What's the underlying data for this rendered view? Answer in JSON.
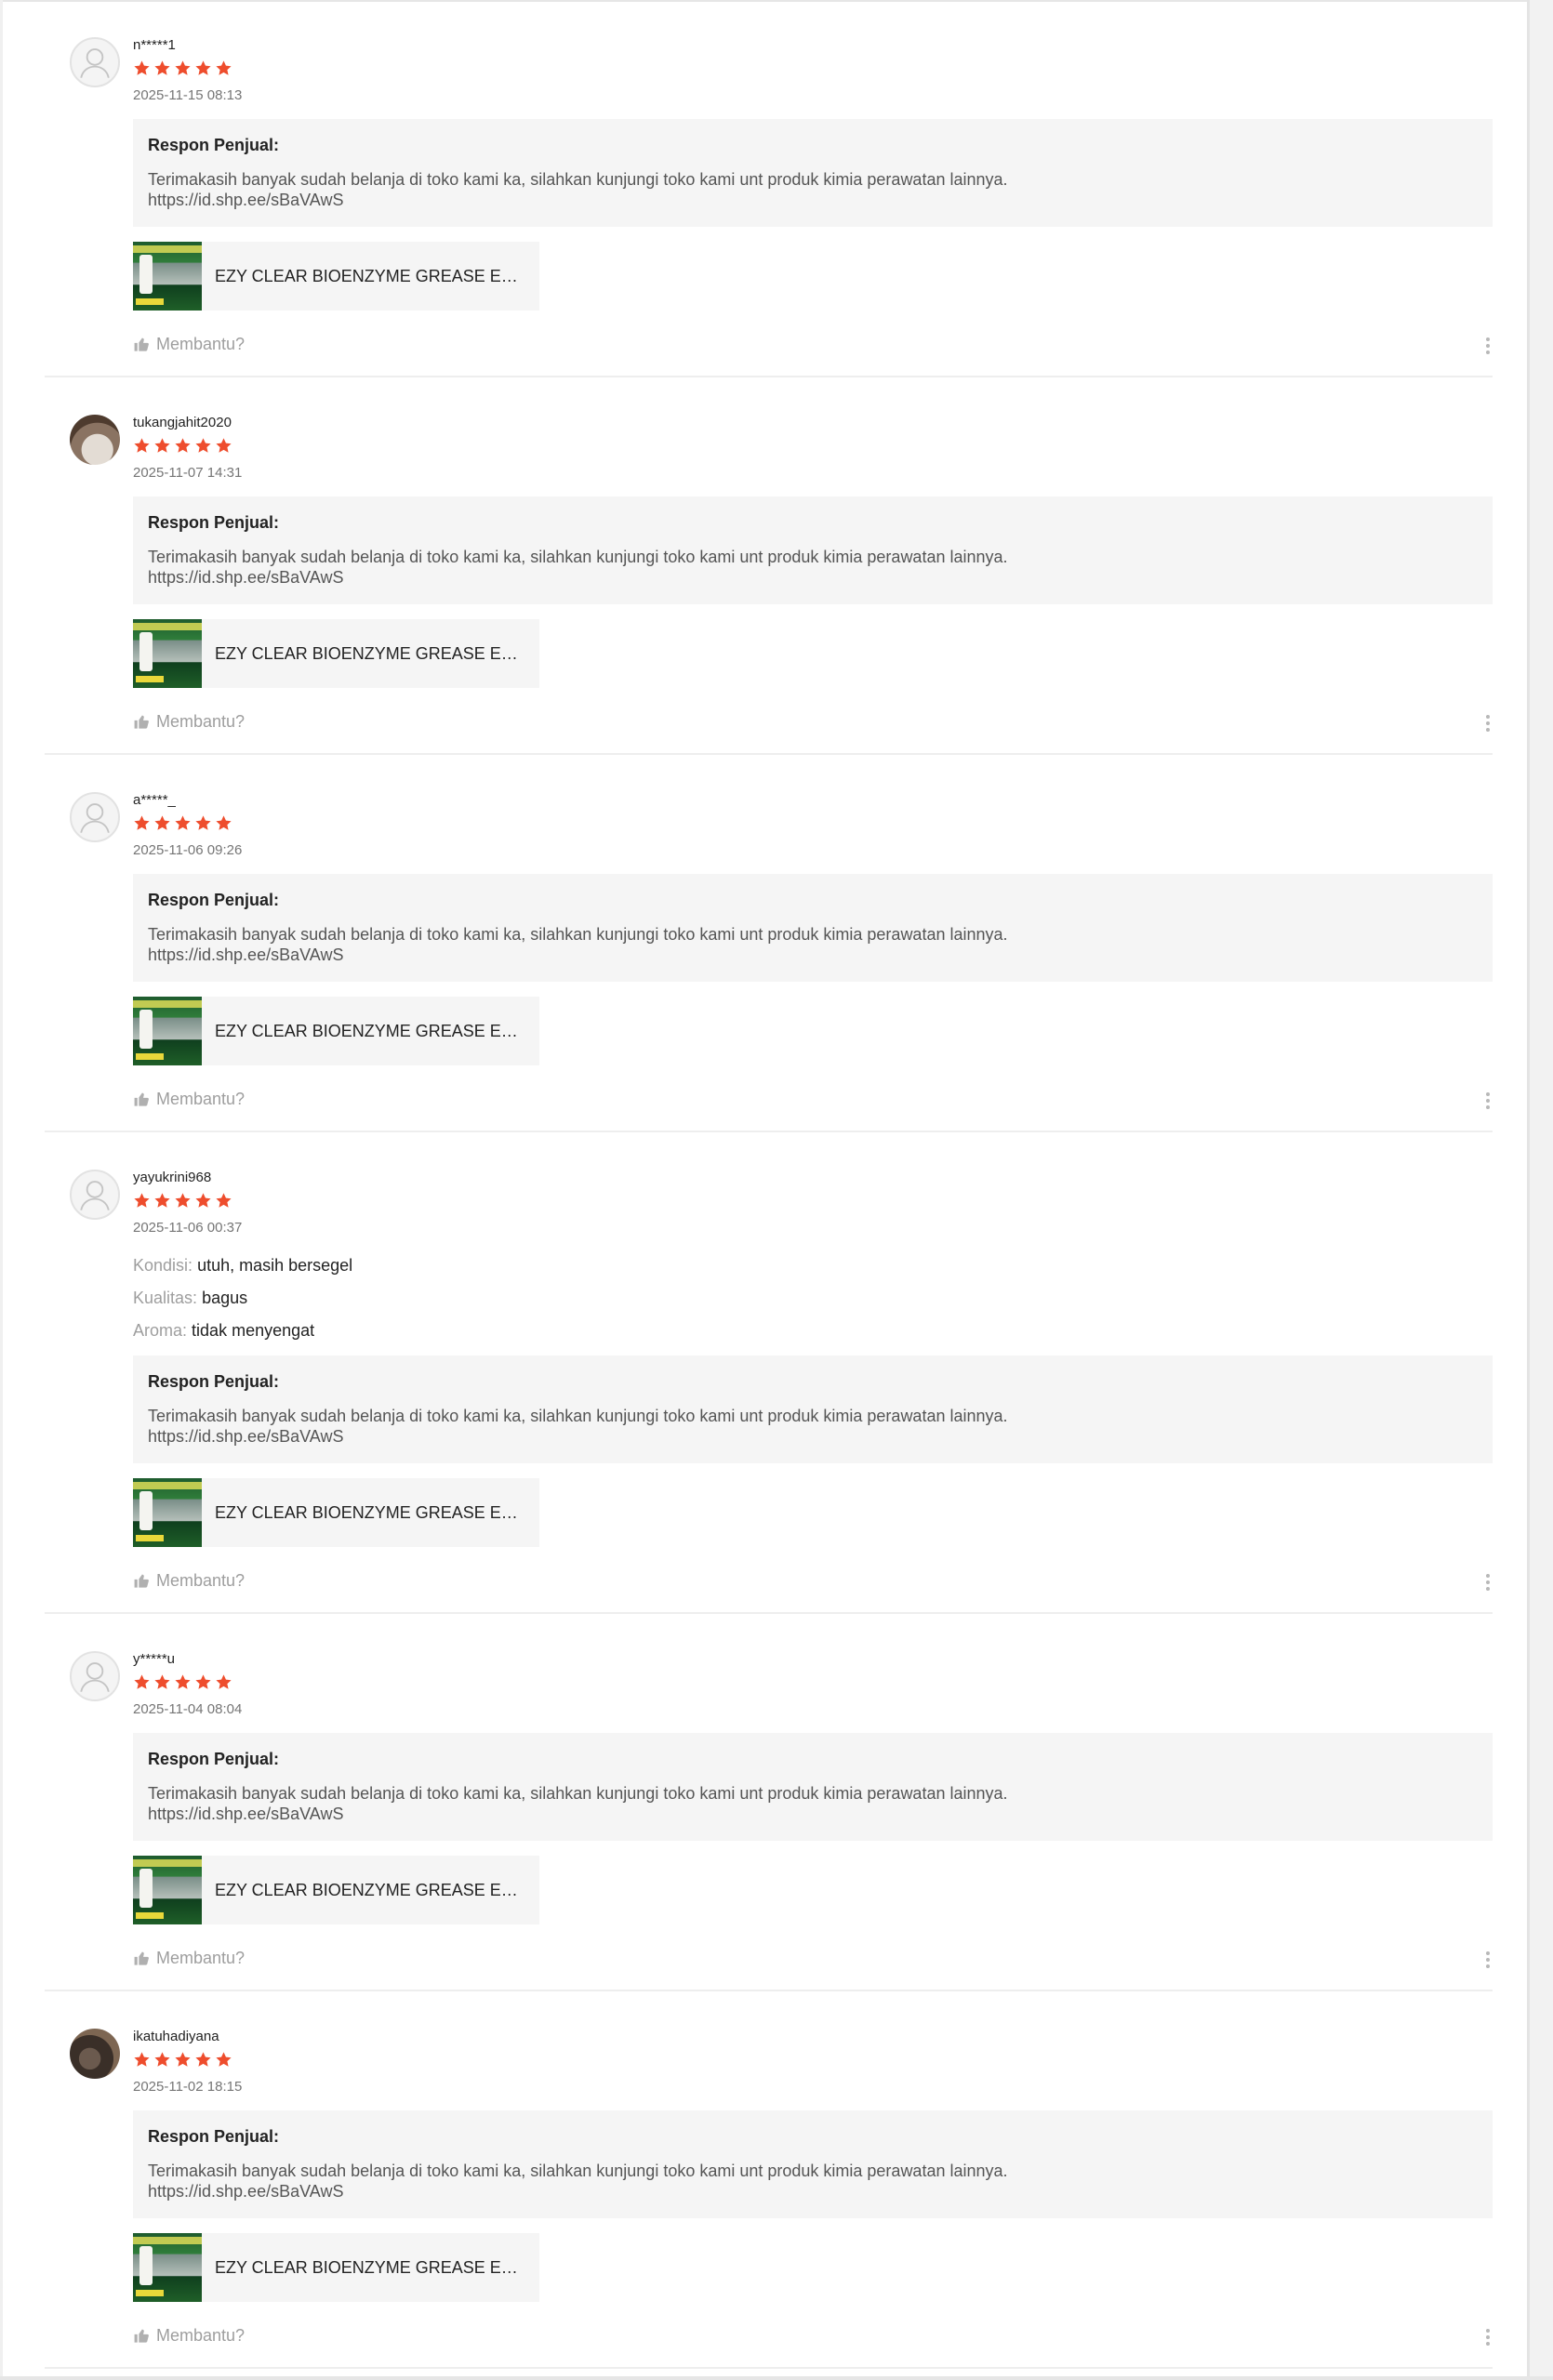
{
  "response_title": "Respon Penjual:",
  "helpful_label": "Membantu?",
  "accent_color": "#ee4d2d",
  "reviews": [
    {
      "username": "n*****1",
      "rating": 5,
      "date": "2025-11-15 08:13",
      "avatar": "placeholder",
      "attributes": [],
      "response": "Terimakasih banyak sudah belanja di toko kami ka, silahkan kunjungi toko kami unt produk kimia perawatan lainnya.\n https://id.shp.ee/sBaVAwS",
      "product_name": "EZY CLEAR BIOENZYME GREASE EATER"
    },
    {
      "username": "tukangjahit2020",
      "rating": 5,
      "date": "2025-11-07 14:31",
      "avatar": "photo",
      "attributes": [],
      "response": "Terimakasih banyak sudah belanja di toko kami ka, silahkan kunjungi toko kami unt produk kimia perawatan lainnya.\n https://id.shp.ee/sBaVAwS",
      "product_name": "EZY CLEAR BIOENZYME GREASE EATER"
    },
    {
      "username": "a*****_",
      "rating": 5,
      "date": "2025-11-06 09:26",
      "avatar": "placeholder",
      "attributes": [],
      "response": "Terimakasih banyak sudah belanja di toko kami ka, silahkan kunjungi toko kami unt produk kimia perawatan lainnya.\n https://id.shp.ee/sBaVAwS",
      "product_name": "EZY CLEAR BIOENZYME GREASE EATER"
    },
    {
      "username": "yayukrini968",
      "rating": 5,
      "date": "2025-11-06 00:37",
      "avatar": "placeholder",
      "attributes": [
        {
          "key": "Kondisi:",
          "value": "utuh, masih bersegel"
        },
        {
          "key": "Kualitas:",
          "value": "bagus"
        },
        {
          "key": "Aroma:",
          "value": "tidak menyengat"
        }
      ],
      "response": "Terimakasih banyak sudah belanja di toko kami ka, silahkan kunjungi toko kami unt produk kimia perawatan lainnya.\n https://id.shp.ee/sBaVAwS",
      "product_name": "EZY CLEAR BIOENZYME GREASE EATER"
    },
    {
      "username": "y*****u",
      "rating": 5,
      "date": "2025-11-04 08:04",
      "avatar": "placeholder",
      "attributes": [],
      "response": "Terimakasih banyak sudah belanja di toko kami ka, silahkan kunjungi toko kami unt produk kimia perawatan lainnya.\n https://id.shp.ee/sBaVAwS",
      "product_name": "EZY CLEAR BIOENZYME GREASE EATER"
    },
    {
      "username": "ikatuhadiyana",
      "rating": 5,
      "date": "2025-11-02 18:15",
      "avatar": "photo",
      "attributes": [],
      "response": "Terimakasih banyak sudah belanja di toko kami ka, silahkan kunjungi toko kami unt produk kimia perawatan lainnya.\n https://id.shp.ee/sBaVAwS",
      "product_name": "EZY CLEAR BIOENZYME GREASE EATER"
    }
  ]
}
